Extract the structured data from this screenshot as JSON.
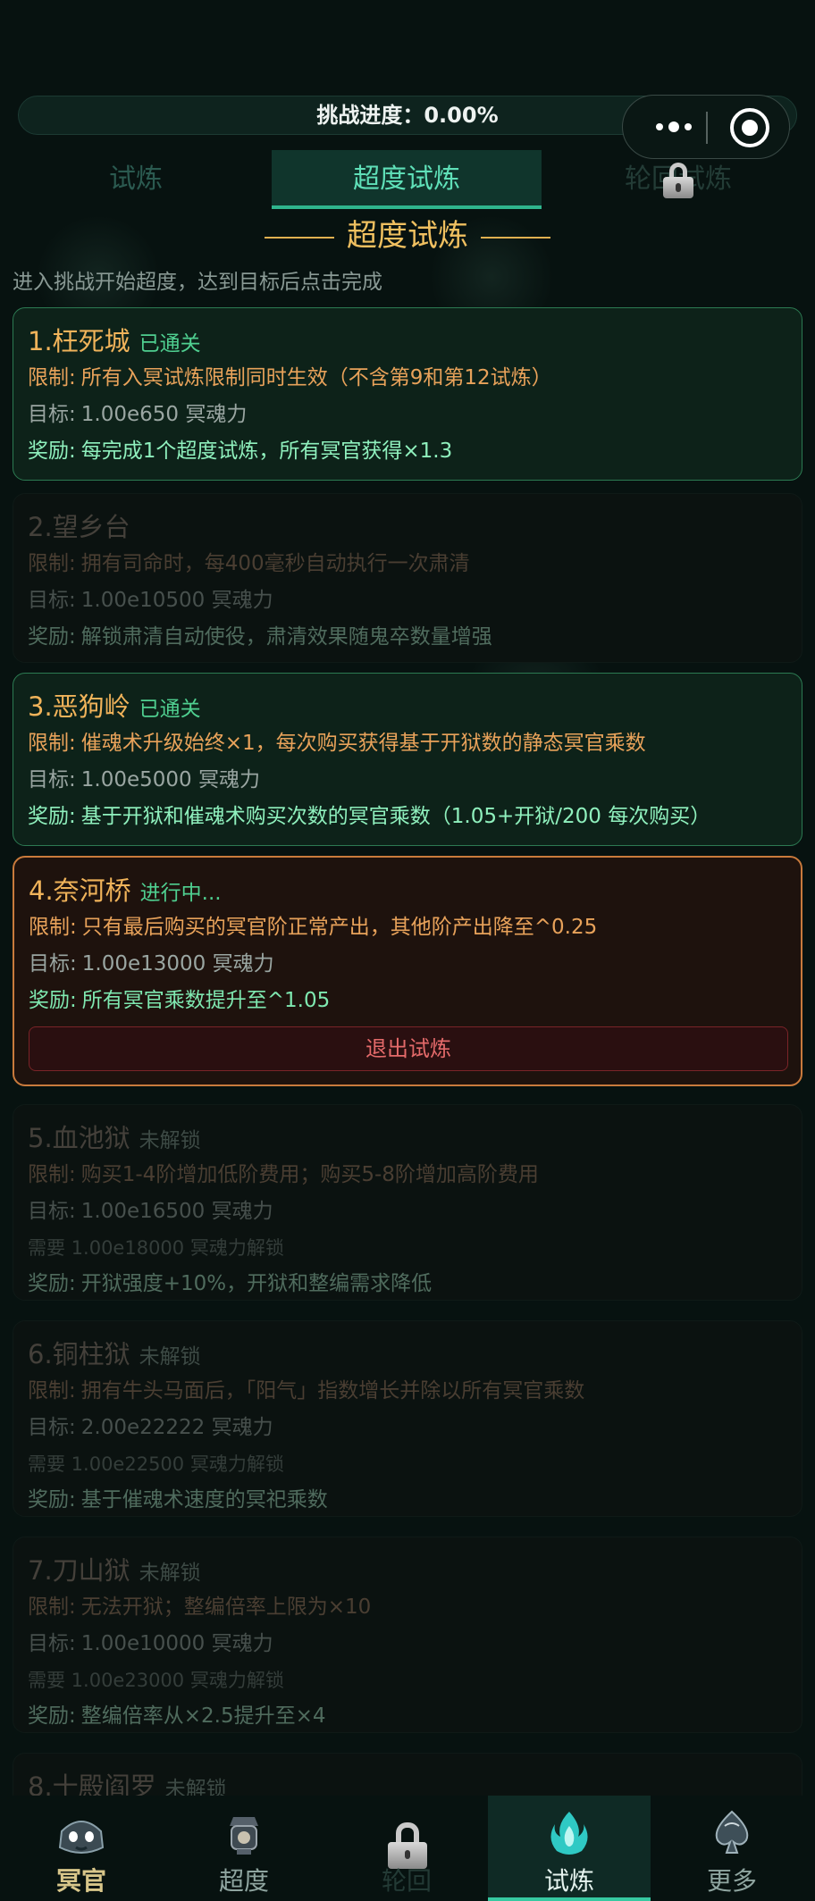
{
  "progress": {
    "label": "挑战进度：0.00%",
    "value": 0.0
  },
  "capsule": {
    "more_icon": "more-dots-icon",
    "close_icon": "target-circle-icon"
  },
  "tabs": [
    {
      "label": "试炼",
      "state": "inactive"
    },
    {
      "label": "超度试炼",
      "state": "active"
    },
    {
      "label": "轮回试炼",
      "state": "locked"
    }
  ],
  "section": {
    "title": "超度试炼",
    "intro": "进入挑战开始超度，达到目标后点击完成"
  },
  "labels": {
    "limit": "限制:",
    "target": "目标:",
    "reward": "奖励:"
  },
  "challenges": [
    {
      "name": "1.枉死城",
      "status": "已通关",
      "limit": "所有入冥试炼限制同时生效（不含第9和第12试炼）",
      "target": "1.00e650 冥魂力",
      "reward": "每完成1个超度试炼，所有冥官获得×1.3"
    },
    {
      "name": "2.望乡台",
      "status": "",
      "limit": "拥有司命时，每400毫秒自动执行一次肃清",
      "target": "1.00e10500 冥魂力",
      "reward": "解锁肃清自动使役，肃清效果随鬼卒数量增强"
    },
    {
      "name": "3.恶狗岭",
      "status": "已通关",
      "limit": "催魂术升级始终×1，每次购买获得基于开狱数的静态冥官乘数",
      "target": "1.00e5000 冥魂力",
      "reward": "基于开狱和催魂术购买次数的冥官乘数（1.05+开狱/200 每次购买）"
    },
    {
      "name": "4.奈河桥",
      "status": "进行中...",
      "limit": "只有最后购买的冥官阶正常产出，其他阶产出降至^0.25",
      "target": "1.00e13000 冥魂力",
      "reward": "所有冥官乘数提升至^1.05",
      "button": "退出试炼"
    },
    {
      "name": "5.血池狱",
      "status": "未解锁",
      "limit": "购买1-4阶增加低阶费用；购买5-8阶增加高阶费用",
      "target": "1.00e16500 冥魂力",
      "need": "需要 1.00e18000 冥魂力解锁",
      "reward": "开狱强度+10%，开狱和整编需求降低"
    },
    {
      "name": "6.铜柱狱",
      "status": "未解锁",
      "limit": "拥有牛头马面后，「阳气」指数增长并除以所有冥官乘数",
      "target": "2.00e22222 冥魂力",
      "need": "需要 1.00e22500 冥魂力解锁",
      "reward": "基于催魂术速度的冥祀乘数"
    },
    {
      "name": "7.刀山狱",
      "status": "未解锁",
      "limit": "无法开狱；整编倍率上限为×10",
      "target": "1.00e10000 冥魂力",
      "need": "需要 1.00e23000 冥魂力解锁",
      "reward": "整编倍率从×2.5提升至×4"
    },
    {
      "name": "8.十殿阎罗",
      "status": "未解锁"
    }
  ],
  "nav": [
    {
      "label": "冥官",
      "icon": "ghost-mask-icon",
      "state": "normal"
    },
    {
      "label": "超度",
      "icon": "lantern-icon",
      "state": "normal"
    },
    {
      "label": "轮回",
      "icon": "lock-icon",
      "state": "locked"
    },
    {
      "label": "试炼",
      "icon": "blue-flame-icon",
      "state": "active"
    },
    {
      "label": "更多",
      "icon": "spade-crest-icon",
      "state": "normal"
    }
  ]
}
